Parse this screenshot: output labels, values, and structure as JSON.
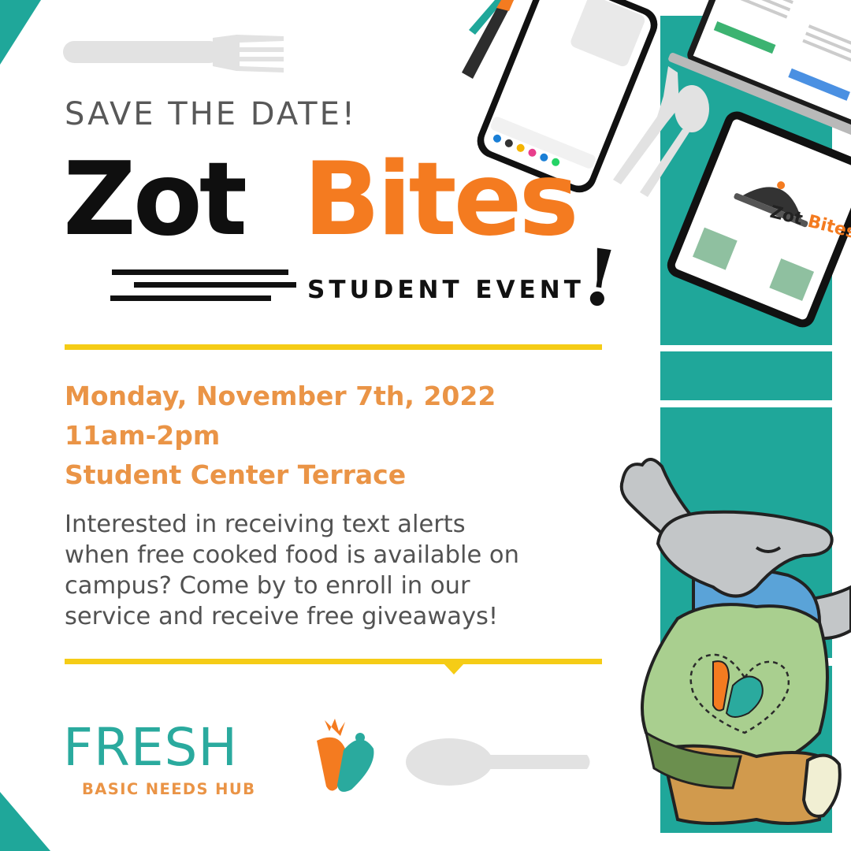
{
  "headline": {
    "save_the_date": "SAVE THE DATE!",
    "zot": "Zot",
    "bites": "Bites",
    "student_event": "STUDENT EVENT",
    "exclamation": "!"
  },
  "event": {
    "date": "Monday, November 7th, 2022",
    "time": "11am-2pm",
    "location": "Student Center Terrace"
  },
  "description_lines": [
    "Interested in receiving text alerts",
    "when free cooked food is available on",
    "campus? Come by to enroll in our",
    "service and receive free giveaways!"
  ],
  "logo": {
    "fresh": "FRESH",
    "subtitle": "BASIC NEEDS HUB"
  },
  "tablet_logo": {
    "zot": "Zot",
    "bites": "Bites"
  },
  "colors": {
    "teal": "#1fa79a",
    "orange": "#f47b20",
    "light_orange": "#ea9446",
    "yellow": "#f5cc16",
    "dark_text": "#111111",
    "gray_text": "#525252",
    "utensil_gray": "#e2e2e2"
  },
  "icons": [
    "fork-icon",
    "spoon-icon",
    "phone-illustration",
    "laptop-illustration",
    "tablet-illustration",
    "anteater-mascot",
    "carrot-icon"
  ]
}
